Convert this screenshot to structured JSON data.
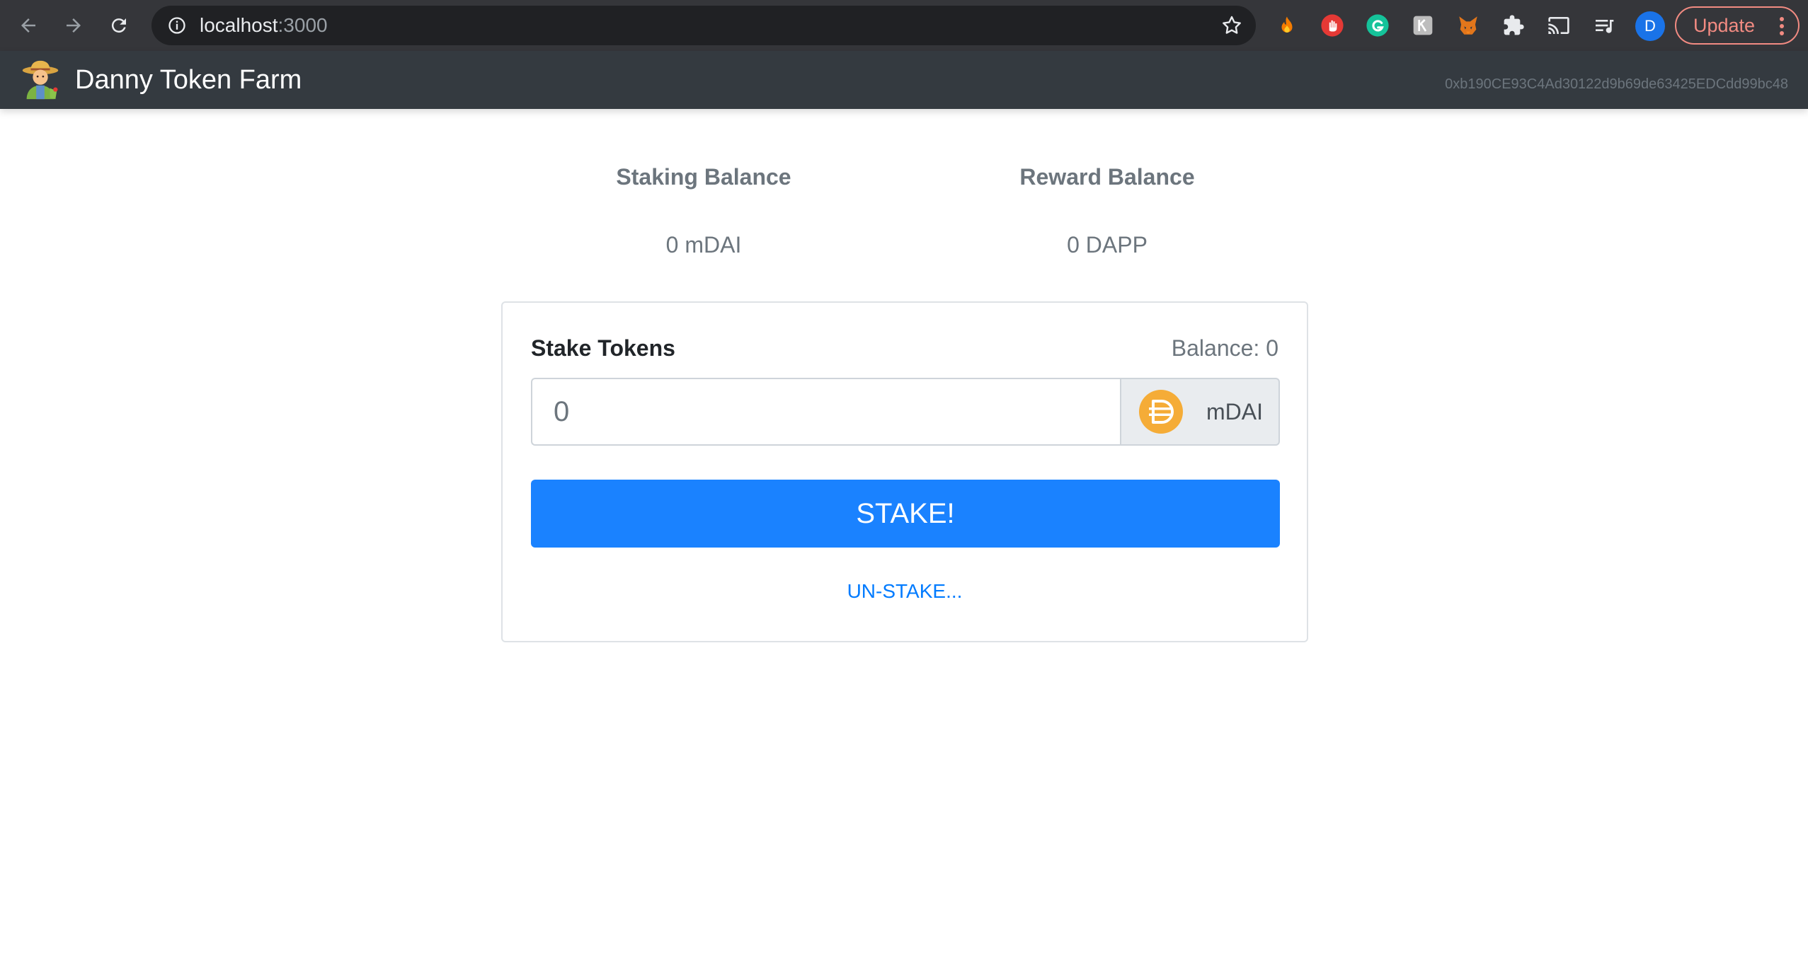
{
  "browser": {
    "url_host": "localhost",
    "url_port": ":3000",
    "profile_initial": "D",
    "update_label": "Update"
  },
  "navbar": {
    "brand_icon": "farmer-emoji",
    "title": "Danny Token Farm",
    "account": "0xb190CE93C4Ad30122d9b69de63425EDCdd99bc48"
  },
  "balances": {
    "staking": {
      "heading": "Staking Balance",
      "value": "0 mDAI"
    },
    "reward": {
      "heading": "Reward Balance",
      "value": "0 DAPP"
    }
  },
  "stake_card": {
    "title": "Stake Tokens",
    "balance_label": "Balance: 0",
    "input_placeholder": "0",
    "token_icon": "dai-coin-icon",
    "token_symbol": "mDAI",
    "stake_button": "STAKE!",
    "unstake_link": "UN-STAKE..."
  },
  "colors": {
    "chrome_bg": "#35363a",
    "navbar_bg": "#343a40",
    "primary": "#1a82ff",
    "link": "#007bff",
    "dai": "#f5ac37"
  }
}
